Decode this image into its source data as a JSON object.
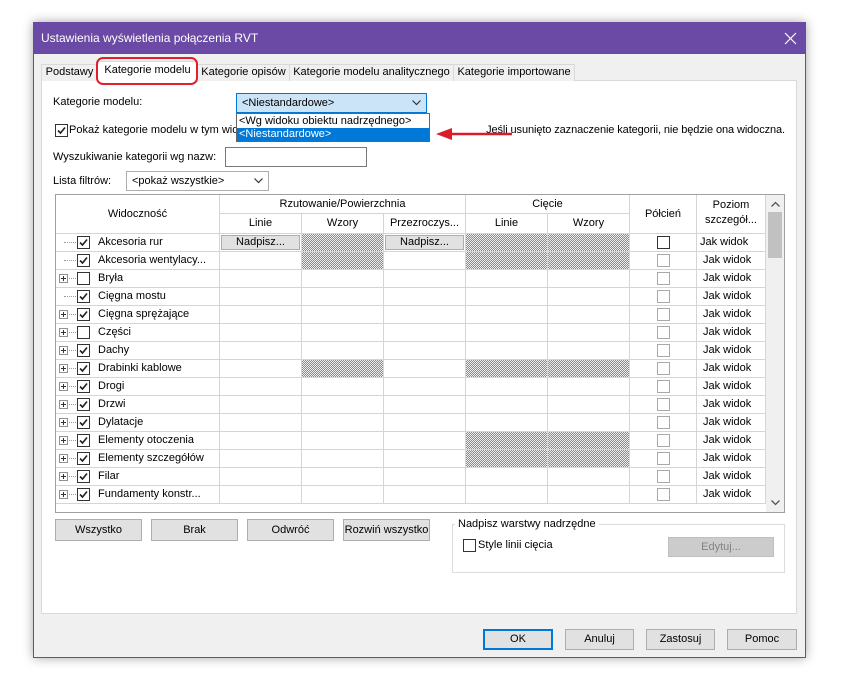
{
  "window": {
    "title": "Ustawienia wyświetlenia połączenia RVT"
  },
  "icons": {
    "close": "close-icon",
    "dropdown": "chevron-down-icon",
    "expand": "expand-plus-icon",
    "check": "checkmark-icon",
    "scroll_up": "chevron-up-icon",
    "scroll_down": "chevron-down-icon",
    "annotation": "red-arrow-icon"
  },
  "colors": {
    "title_bar": "#6B4AA5",
    "accent": "#0078D7",
    "annotation_red": "#E0202C"
  },
  "tabs": [
    {
      "label": "Podstawy",
      "active": false
    },
    {
      "label": "Kategorie modelu",
      "active": true
    },
    {
      "label": "Kategorie opisów",
      "active": false
    },
    {
      "label": "Kategorie modelu analitycznego",
      "active": false
    },
    {
      "label": "Kategorie importowane",
      "active": false
    }
  ],
  "model_categories": {
    "label": "Kategorie modelu:",
    "selected": "<Niestandardowe>",
    "open": true,
    "options": [
      "<Wg widoku obiektu nadrzędnego>",
      "<Niestandardowe>"
    ]
  },
  "show_model_categories": {
    "label": "Pokaż kategorie modelu w tym wido",
    "checked": true
  },
  "hint": "Jeśli usunięto zaznaczenie kategorii, nie będzie ona widoczna.",
  "search": {
    "label": "Wyszukiwanie kategorii wg nazw:",
    "value": ""
  },
  "filter_list": {
    "label": "Lista filtrów:",
    "selected": "<pokaż wszystkie>"
  },
  "grid": {
    "headers": {
      "visibility": "Widoczność",
      "projection": "Rzutowanie/Powierzchnia",
      "proj_lines": "Linie",
      "proj_patterns": "Wzory",
      "transparency": "Przezroczys...",
      "cut": "Cięcie",
      "cut_lines": "Linie",
      "cut_patterns": "Wzory",
      "halftone": "Półcień",
      "detail_line1": "Poziom",
      "detail_line2": "szczegół..."
    },
    "rows": [
      {
        "name": "Akcesoria rur",
        "visible": true,
        "expandable": false,
        "proj_lines": "Nadpisz...",
        "proj_patterns_na": true,
        "transparency": "Nadpisz...",
        "cut_na": true,
        "halftone_enabled": true,
        "selected": true,
        "detail": "Jak widok"
      },
      {
        "name": "Akcesoria wentylacy...",
        "visible": true,
        "expandable": false,
        "proj_lines": "",
        "proj_patterns_na": true,
        "transparency": "",
        "cut_na": true,
        "halftone_enabled": false,
        "selected": false,
        "detail": "Jak widok"
      },
      {
        "name": "Bryła",
        "visible": false,
        "expandable": true,
        "proj_lines": "",
        "proj_patterns_na": false,
        "transparency": "",
        "cut_na": false,
        "halftone_enabled": false,
        "selected": false,
        "detail": "Jak widok"
      },
      {
        "name": "Cięgna mostu",
        "visible": true,
        "expandable": false,
        "proj_lines": "",
        "proj_patterns_na": false,
        "transparency": "",
        "cut_na": false,
        "halftone_enabled": false,
        "selected": false,
        "detail": "Jak widok"
      },
      {
        "name": "Cięgna sprężające",
        "visible": true,
        "expandable": true,
        "proj_lines": "",
        "proj_patterns_na": false,
        "transparency": "",
        "cut_na": false,
        "halftone_enabled": false,
        "selected": false,
        "detail": "Jak widok"
      },
      {
        "name": "Części",
        "visible": false,
        "expandable": true,
        "proj_lines": "",
        "proj_patterns_na": false,
        "transparency": "",
        "cut_na": false,
        "halftone_enabled": false,
        "selected": false,
        "detail": "Jak widok"
      },
      {
        "name": "Dachy",
        "visible": true,
        "expandable": true,
        "proj_lines": "",
        "proj_patterns_na": false,
        "transparency": "",
        "cut_na": false,
        "halftone_enabled": false,
        "selected": false,
        "detail": "Jak widok"
      },
      {
        "name": "Drabinki kablowe",
        "visible": true,
        "expandable": true,
        "proj_lines": "",
        "proj_patterns_na": true,
        "transparency": "",
        "cut_na": true,
        "halftone_enabled": false,
        "selected": false,
        "detail": "Jak widok"
      },
      {
        "name": "Drogi",
        "visible": true,
        "expandable": true,
        "proj_lines": "",
        "proj_patterns_na": false,
        "transparency": "",
        "cut_na": false,
        "halftone_enabled": false,
        "selected": false,
        "detail": "Jak widok"
      },
      {
        "name": "Drzwi",
        "visible": true,
        "expandable": true,
        "proj_lines": "",
        "proj_patterns_na": false,
        "transparency": "",
        "cut_na": false,
        "halftone_enabled": false,
        "selected": false,
        "detail": "Jak widok"
      },
      {
        "name": "Dylatacje",
        "visible": true,
        "expandable": true,
        "proj_lines": "",
        "proj_patterns_na": false,
        "transparency": "",
        "cut_na": false,
        "halftone_enabled": false,
        "selected": false,
        "detail": "Jak widok"
      },
      {
        "name": "Elementy otoczenia",
        "visible": true,
        "expandable": true,
        "proj_lines": "",
        "proj_patterns_na": false,
        "transparency": "",
        "cut_na": true,
        "halftone_enabled": false,
        "selected": false,
        "detail": "Jak widok"
      },
      {
        "name": "Elementy szczegółów",
        "visible": true,
        "expandable": true,
        "proj_lines": "",
        "proj_patterns_na": false,
        "transparency": "",
        "cut_na": true,
        "halftone_enabled": false,
        "selected": false,
        "detail": "Jak widok"
      },
      {
        "name": "Filar",
        "visible": true,
        "expandable": true,
        "proj_lines": "",
        "proj_patterns_na": false,
        "transparency": "",
        "cut_na": false,
        "halftone_enabled": false,
        "selected": false,
        "detail": "Jak widok"
      },
      {
        "name": "Fundamenty konstr...",
        "visible": true,
        "expandable": true,
        "proj_lines": "",
        "proj_patterns_na": false,
        "transparency": "",
        "cut_na": false,
        "halftone_enabled": false,
        "selected": false,
        "detail": "Jak widok"
      }
    ]
  },
  "grid_buttons": {
    "all": "Wszystko",
    "none": "Brak",
    "invert": "Odwróć",
    "expand_all": "Rozwiń wszystko"
  },
  "override_group": {
    "title": "Nadpisz warstwy nadrzędne",
    "cut_line_styles": "Style linii cięcia",
    "cut_line_styles_checked": false,
    "edit": "Edytuj..."
  },
  "footer": {
    "ok": "OK",
    "cancel": "Anuluj",
    "apply": "Zastosuj",
    "help": "Pomoc"
  }
}
